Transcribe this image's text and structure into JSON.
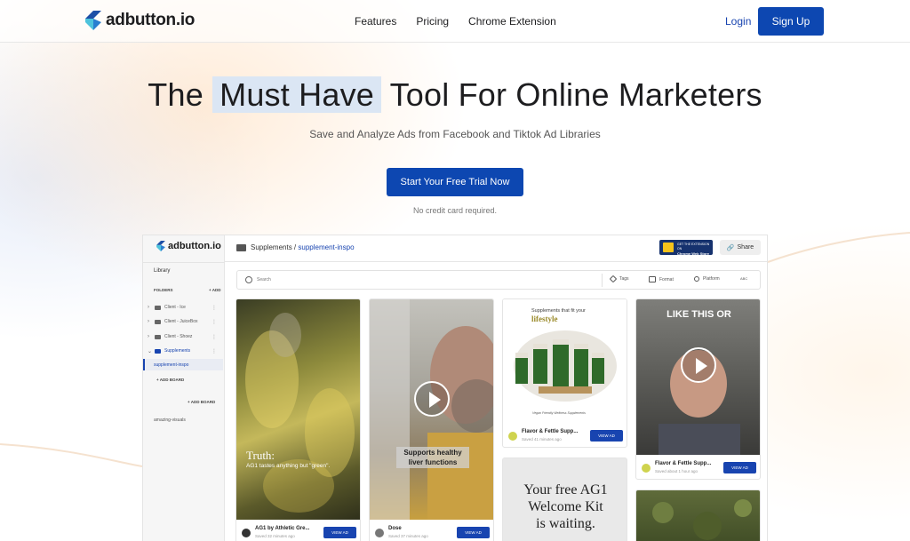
{
  "brand": {
    "name": "adbutton.io",
    "accent": "#0d47b1",
    "logo_icon": "adbutton-logo-icon"
  },
  "nav": {
    "links": [
      "Features",
      "Pricing",
      "Chrome Extension"
    ],
    "login": "Login",
    "signup": "Sign Up"
  },
  "hero": {
    "title_pre": "The",
    "title_highlight": "Must Have",
    "title_post": "Tool For Online Marketers",
    "subtitle": "Save and Analyze Ads from Facebook and Tiktok Ad Libraries",
    "cta": "Start Your Free Trial Now",
    "note": "No credit card required."
  },
  "app": {
    "logo": "adbutton.io",
    "sidebar": {
      "library": "Library",
      "folders_label": "FOLDERS",
      "add_label": "+ ADD",
      "folders": [
        "Client - Ice",
        "Client - JuiceBox",
        "Client - Shoez",
        "Supplements"
      ],
      "active_board": "supplement-inspo",
      "add_board_inner": "+ ADD BOARD",
      "add_board": "+ ADD BOARD",
      "boards": [
        "amazing-visuals"
      ]
    },
    "breadcrumb": {
      "folder": "Supplements",
      "separator": " / ",
      "board": "supplement-inspo"
    },
    "chrome_badge": {
      "line1": "GET THE EXTENSION ON",
      "line2": "Chrome Web Store"
    },
    "share": "Share",
    "search": {
      "placeholder": "Search"
    },
    "filters": [
      "Tags",
      "Format",
      "Platform",
      "ABC"
    ],
    "cards": [
      {
        "overlay1": "Truth:",
        "overlay2": "AG1 tastes anything but \"green\".",
        "title": "AG1 by Athletic Gre...",
        "saved": "Saved 32 minutes ago",
        "button": "VIEW AD"
      },
      {
        "overlay1": "Supports healthy",
        "overlay2": "liver functions",
        "title": "Dose",
        "saved": "Saved 37 minutes ago",
        "button": "VIEW AD"
      },
      {
        "overlay1": "Supplements that fit your",
        "overlay2": "lifestyle",
        "footer": "Vegan Friendly Wellness Supplements",
        "title": "Flavor & Fettle Supp...",
        "saved": "Saved 41 minutes ago",
        "button": "VIEW AD"
      },
      {
        "overlay1": "Your free AG1",
        "overlay2": "Welcome Kit",
        "overlay3": "is waiting."
      },
      {
        "overlay1": "LIKE THIS OR",
        "title": "Flavor & Fettle Supp...",
        "saved": "Saved about 1 hour ago",
        "button": "VIEW AD"
      }
    ]
  }
}
